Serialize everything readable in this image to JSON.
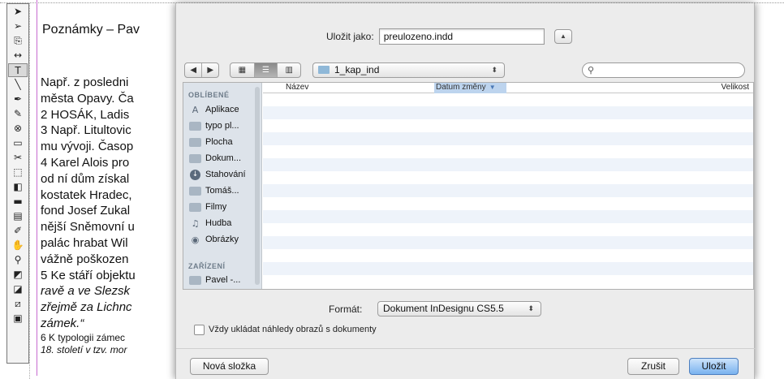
{
  "document": {
    "heading": "Poznámky – Pav",
    "lines": [
      {
        "text": " Např. z posledni",
        "style": "normal"
      },
      {
        "text": "města Opavy. Ča",
        "style": "normal"
      },
      {
        "text": "2 HOSÁK, Ladis",
        "style": "normal"
      },
      {
        "text": "3 Např. Litultovic",
        "style": "normal"
      },
      {
        "text": "mu vývoji. Časop",
        "style": "normal"
      },
      {
        "text": "4 Karel Alois pro",
        "style": "normal"
      },
      {
        "text": "od ní dům získal",
        "style": "normal"
      },
      {
        "text": "kostatek Hradec,",
        "style": "normal"
      },
      {
        "text": "fond Josef Zukal",
        "style": "normal"
      },
      {
        "text": "nější Sněmovní u",
        "style": "normal"
      },
      {
        "text": "palác hrabat Wil",
        "style": "normal"
      },
      {
        "text": "vážně poškozen",
        "style": "normal"
      },
      {
        "text": "5 Ke stáří objektu",
        "style": "normal"
      },
      {
        "text": "ravě a ve Slezsk",
        "style": "italic"
      },
      {
        "text": "zřejmě za Lichnc",
        "style": "italic"
      },
      {
        "text": "zámek.“",
        "style": "mixed"
      },
      {
        "text": "6 K typologii zámec",
        "style": "small"
      },
      {
        "text": "18. století v tzv. mor",
        "style": "small-italic"
      }
    ]
  },
  "toolbox": {
    "tools": [
      {
        "icon": "selection-arrow-icon",
        "glyph": "➤"
      },
      {
        "icon": "direct-selection-icon",
        "glyph": "➢"
      },
      {
        "icon": "page-tool-icon",
        "glyph": "⎘"
      },
      {
        "icon": "gap-tool-icon",
        "glyph": "↔"
      },
      {
        "icon": "type-tool-icon",
        "glyph": "T"
      },
      {
        "icon": "line-tool-icon",
        "glyph": "╲"
      },
      {
        "icon": "pen-tool-icon",
        "glyph": "✒"
      },
      {
        "icon": "pencil-tool-icon",
        "glyph": "✎"
      },
      {
        "icon": "rectangle-frame-icon",
        "glyph": "⊗"
      },
      {
        "icon": "rectangle-tool-icon",
        "glyph": "▭"
      },
      {
        "icon": "scissors-tool-icon",
        "glyph": "✂"
      },
      {
        "icon": "free-transform-icon",
        "glyph": "⬚"
      },
      {
        "icon": "gradient-swatch-icon",
        "glyph": "◧"
      },
      {
        "icon": "gradient-feather-icon",
        "glyph": "▬"
      },
      {
        "icon": "note-tool-icon",
        "glyph": "▤"
      },
      {
        "icon": "eyedropper-icon",
        "glyph": "✐"
      },
      {
        "icon": "hand-tool-icon",
        "glyph": "✋"
      },
      {
        "icon": "zoom-tool-icon",
        "glyph": "⚲"
      },
      {
        "icon": "fill-stroke-icon",
        "glyph": "◩"
      },
      {
        "icon": "default-colors-icon",
        "glyph": "◪"
      },
      {
        "icon": "apply-none-icon",
        "glyph": "⧄"
      },
      {
        "icon": "view-mode-icon",
        "glyph": "▣"
      }
    ]
  },
  "dialog": {
    "save_as_label": "Uložit jako:",
    "filename": "preulozeno.indd",
    "expand_glyph": "▲",
    "back_glyph": "◀",
    "forward_glyph": "▶",
    "view_icons_glyph": "▦",
    "view_list_glyph": "☰",
    "view_columns_glyph": "▥",
    "location": "1_kap_ind",
    "popup_arrows": "⬍",
    "search_glyph": "⚲",
    "sidebar": {
      "favorites_header": "OBLÍBENÉ",
      "favorites": [
        {
          "label": "Aplikace",
          "icon": "applications-icon",
          "glyph": "A"
        },
        {
          "label": "typo pl...",
          "icon": "folder-icon",
          "glyph": ""
        },
        {
          "label": "Plocha",
          "icon": "desktop-icon",
          "glyph": ""
        },
        {
          "label": "Dokum...",
          "icon": "documents-icon",
          "glyph": ""
        },
        {
          "label": "Stahování",
          "icon": "downloads-icon",
          "glyph": "↓"
        },
        {
          "label": "Tomáš...",
          "icon": "folder-icon",
          "glyph": ""
        },
        {
          "label": "Filmy",
          "icon": "movies-icon",
          "glyph": ""
        },
        {
          "label": "Hudba",
          "icon": "music-icon",
          "glyph": "♫"
        },
        {
          "label": "Obrázky",
          "icon": "pictures-icon",
          "glyph": "◉"
        }
      ],
      "devices_header": "ZAŘÍZENÍ",
      "devices": [
        {
          "label": "Pavel -...",
          "icon": "computer-icon",
          "glyph": ""
        }
      ]
    },
    "columns": {
      "name": "Název",
      "date": "Datum změny",
      "size": "Velikost",
      "sort_glyph": "▼"
    },
    "format_label": "Formát:",
    "format_value": "Dokument InDesignu CS5.5",
    "preview_checkbox_label": "Vždy ukládat náhledy obrazů s dokumenty",
    "preview_checked": false,
    "new_folder_label": "Nová složka",
    "cancel_label": "Zrušit",
    "save_label": "Uložit",
    "accent_color": "#79b2ef"
  }
}
